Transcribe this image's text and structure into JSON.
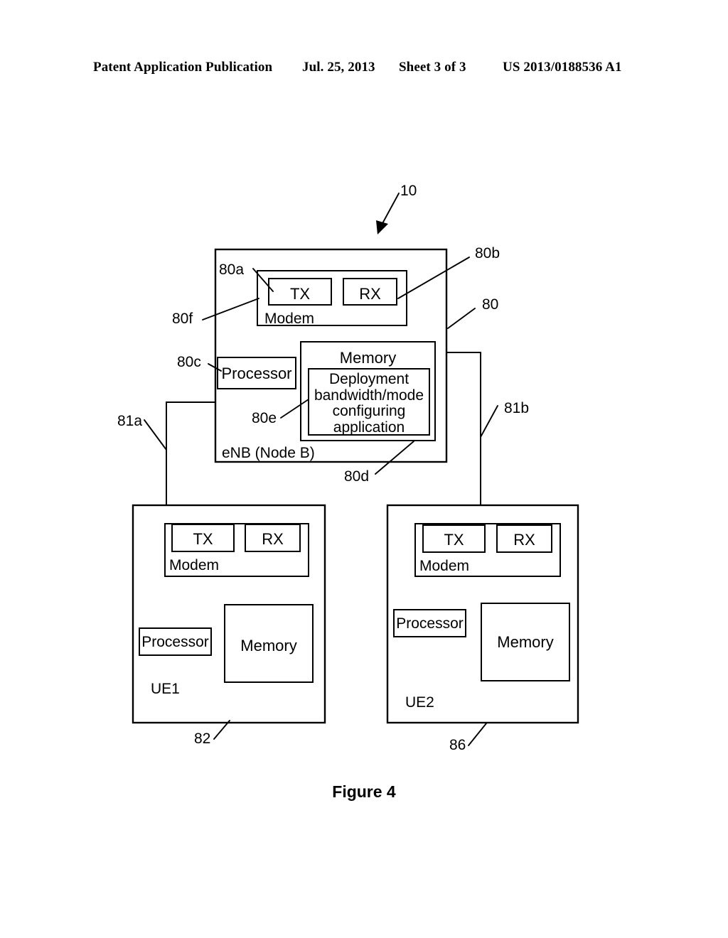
{
  "header": {
    "publication": "Patent Application Publication",
    "date": "Jul. 25, 2013",
    "sheet": "Sheet 3 of 3",
    "number": "US 2013/0188536 A1"
  },
  "figure": {
    "caption": "Figure 4",
    "system_ref": "10"
  },
  "enb": {
    "label": "eNB (Node B)",
    "ref": "80",
    "modem": {
      "label": "Modem",
      "ref": "80f",
      "tx": {
        "label": "TX",
        "ref": "80a"
      },
      "rx": {
        "label": "RX",
        "ref": "80b"
      }
    },
    "processor": {
      "label": "Processor",
      "ref": "80c"
    },
    "memory": {
      "label": "Memory",
      "ref": "80d",
      "application": {
        "lines": [
          "Deployment",
          "bandwidth/mode",
          "configuring",
          "application"
        ],
        "ref": "80e"
      }
    }
  },
  "links": [
    {
      "ref": "81a",
      "from": "enb",
      "to": "ue1"
    },
    {
      "ref": "81b",
      "from": "enb",
      "to": "ue2"
    }
  ],
  "ue1": {
    "label": "UE1",
    "ref": "82",
    "modem": {
      "label": "Modem",
      "tx": {
        "label": "TX"
      },
      "rx": {
        "label": "RX"
      }
    },
    "processor": {
      "label": "Processor"
    },
    "memory": {
      "label": "Memory"
    }
  },
  "ue2": {
    "label": "UE2",
    "ref": "86",
    "modem": {
      "label": "Modem",
      "tx": {
        "label": "TX"
      },
      "rx": {
        "label": "RX"
      }
    },
    "processor": {
      "label": "Processor"
    },
    "memory": {
      "label": "Memory"
    }
  },
  "colors": {
    "ink": "#000000",
    "paper": "#ffffff"
  }
}
